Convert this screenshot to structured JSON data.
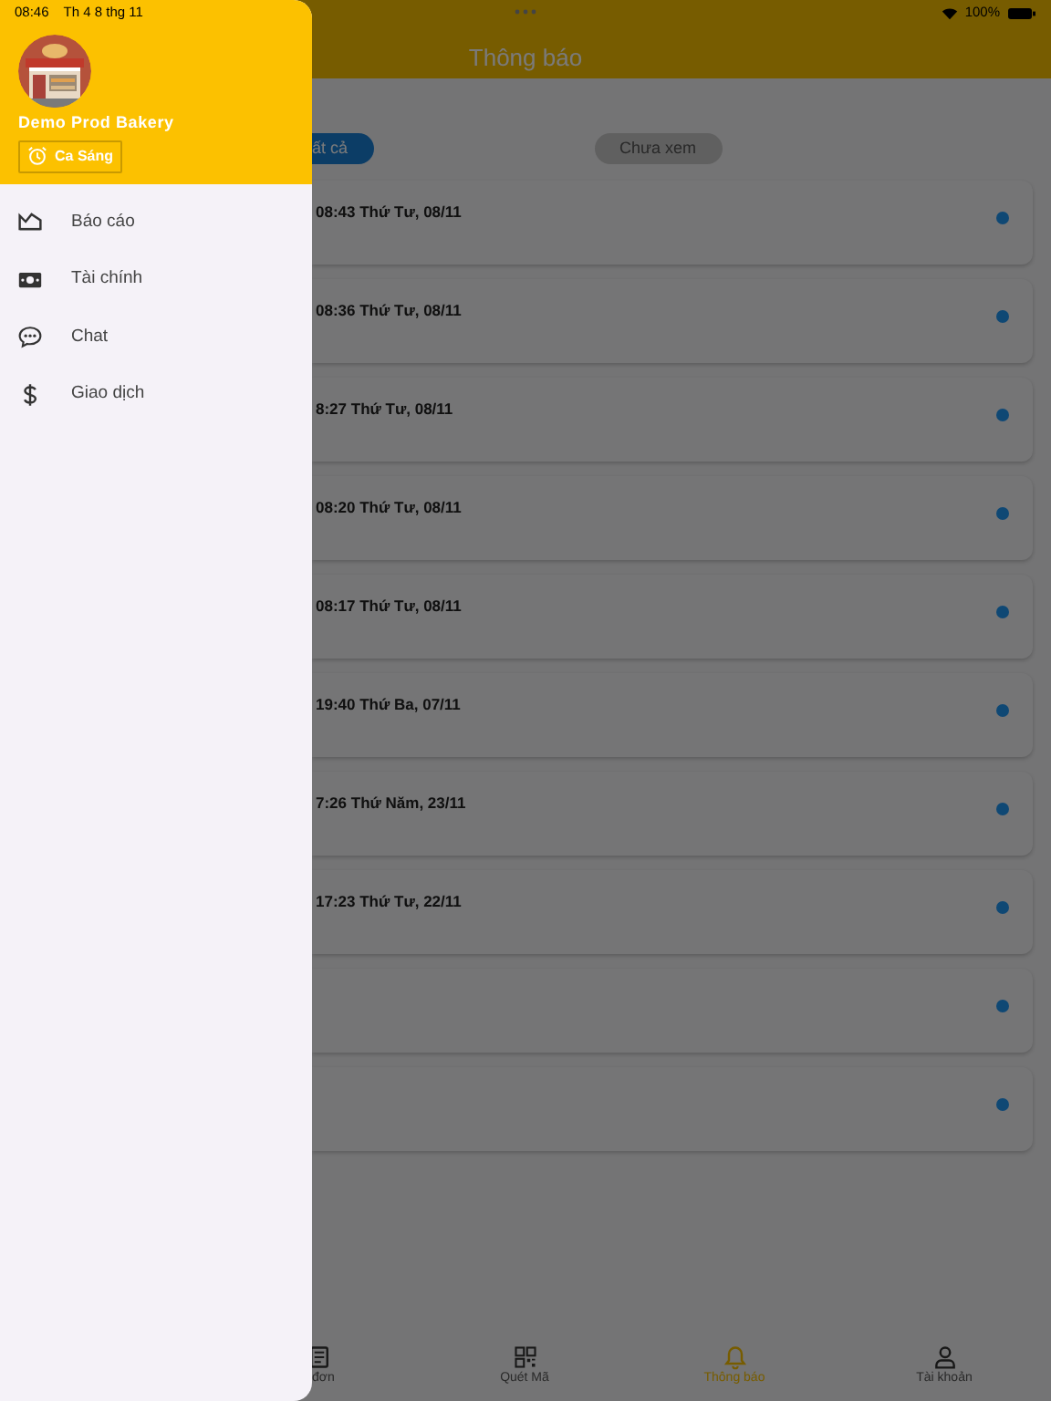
{
  "status_bar": {
    "time": "08:46",
    "date": "Th 4 8 thg 11",
    "battery": "100%"
  },
  "header": {
    "title": "Thông báo"
  },
  "filters": [
    {
      "label": "ất cả",
      "selected": true
    },
    {
      "label": "Chưa xem",
      "selected": false
    }
  ],
  "notifications": [
    {
      "time": "08:43 Thứ Tư, 08/11",
      "unread": true
    },
    {
      "time": "08:36 Thứ Tư, 08/11",
      "unread": true
    },
    {
      "time": "8:27 Thứ Tư, 08/11",
      "unread": true
    },
    {
      "time": "08:20 Thứ Tư, 08/11",
      "unread": true
    },
    {
      "time": "08:17 Thứ Tư, 08/11",
      "unread": true
    },
    {
      "time": "19:40 Thứ Ba, 07/11",
      "unread": true
    },
    {
      "time": "7:26 Thứ Năm, 23/11",
      "unread": true
    },
    {
      "time": "17:23 Thứ Tư, 22/11",
      "unread": true
    },
    {
      "unread": true
    },
    {
      "unread": true
    }
  ],
  "bottom_nav": [
    {
      "label": "đơn",
      "kind": "receipt",
      "selected": false
    },
    {
      "label": "Quét Mã",
      "kind": "qr",
      "selected": false
    },
    {
      "label": "Thông báo",
      "kind": "bell",
      "selected": true
    },
    {
      "label": "Tài khoản",
      "kind": "person",
      "selected": false
    }
  ],
  "drawer": {
    "store_name": "Demo Prod Bakery",
    "shift": "Ca Sáng",
    "menu": [
      {
        "label": "Báo cáo",
        "kind": "chart"
      },
      {
        "label": "Tài chính",
        "kind": "money"
      },
      {
        "label": "Chat",
        "kind": "chat"
      },
      {
        "label": "Giao dịch",
        "kind": "dollar"
      }
    ]
  }
}
